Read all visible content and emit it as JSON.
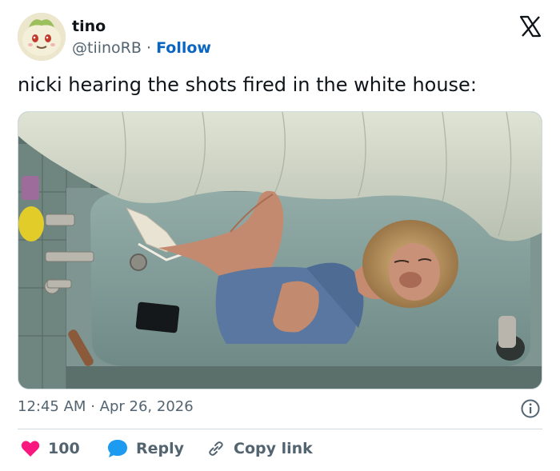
{
  "author": {
    "display_name": "tino",
    "handle": "@tiinoRB",
    "separator": "·",
    "follow_label": "Follow"
  },
  "tweet": {
    "text": "nicki hearing the shots fired in the white house:"
  },
  "meta": {
    "time": "12:45 AM",
    "separator": "·",
    "date": "Apr 26, 2026"
  },
  "actions": {
    "like_count": "100",
    "reply_label": "Reply",
    "copy_link_label": "Copy link"
  },
  "icons": {
    "like": "heart-icon",
    "reply": "speech-bubble-icon",
    "copy": "link-icon",
    "brand": "x-logo-icon",
    "info": "info-icon"
  },
  "colors": {
    "like": "#f91880",
    "reply": "#1d9bf0",
    "follow": "#0a66c2",
    "secondary_text": "#536471"
  }
}
